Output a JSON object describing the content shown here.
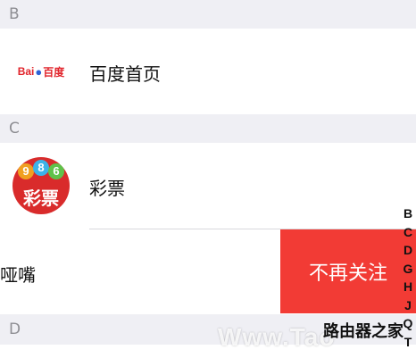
{
  "sections": [
    {
      "letter": "B"
    },
    {
      "letter": "C"
    },
    {
      "letter": "D"
    }
  ],
  "items": [
    {
      "name": "百度首页",
      "icon": "baidu-logo-icon",
      "logo_text_left": "Bai",
      "logo_text_right": "百度"
    },
    {
      "name": "彩票",
      "icon": "lottery-icon",
      "balls": [
        "9",
        "8",
        "6"
      ],
      "icon_text": "彩票"
    },
    {
      "name": "哑嘴",
      "icon": "none"
    }
  ],
  "swipe_action": {
    "label": "不再关注",
    "color": "#f23b35"
  },
  "index_letters": [
    "B",
    "C",
    "D",
    "G",
    "H",
    "J",
    "Q",
    "T"
  ],
  "watermark": {
    "latin": "Www.Tao",
    "cn": "路由器之家"
  }
}
